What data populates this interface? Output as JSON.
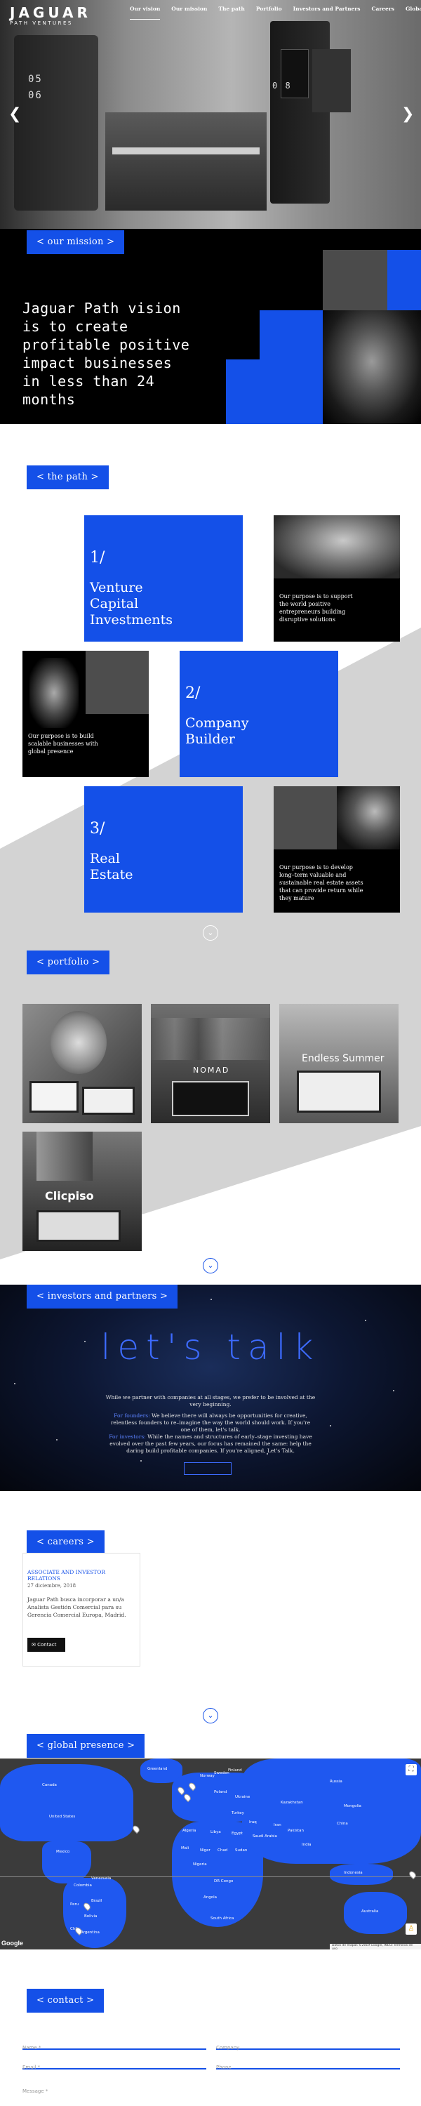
{
  "header": {
    "logo_main": "JAGUAR",
    "logo_sub": "PATH VENTURES",
    "nav": [
      "Our vision",
      "Our mission",
      "The path",
      "Portfolio",
      "Investors and Partners",
      "Careers",
      "Global presence"
    ],
    "active_nav": "Our vision",
    "hero_digits_left": "05",
    "hero_digits_left2": "06",
    "hero_digits_right": "0 8",
    "prev_arrow": "❮",
    "next_arrow": "❯"
  },
  "mission": {
    "tag": "< our mission >",
    "text": "Jaguar Path vision is to create profitable positive impact businesses in less than 24 months"
  },
  "path": {
    "tag": "< the path >",
    "items": [
      {
        "num": "1/",
        "title_line1": "Venture",
        "title_line2": "Capital",
        "title_line3": "Investments",
        "desc": "Our purpose is to support the world positive entrepreneurs building disruptive solutions"
      },
      {
        "num": "2/",
        "title_line1": "Company",
        "title_line2": "Builder",
        "title_line3": "",
        "desc": "Our purpose is to build scalable businesses with global presence"
      },
      {
        "num": "3/",
        "title_line1": "Real",
        "title_line2": "Estate",
        "title_line3": "",
        "desc": "Our purpose is to develop long–term valuable and sustainable real estate assets that can provide return while they mature"
      }
    ],
    "down_icon": "⌄"
  },
  "portfolio": {
    "tag": "< portfolio >",
    "items": [
      {
        "name": "portfolio-item-1",
        "label": ""
      },
      {
        "name": "portfolio-item-nomad",
        "label": "NOMAD"
      },
      {
        "name": "portfolio-item-endless-summer",
        "label": "Endless Summer"
      },
      {
        "name": "portfolio-item-clicpiso",
        "label": "Clicpiso"
      }
    ],
    "down_icon": "⌄"
  },
  "investors": {
    "tag": "< investors and partners >",
    "title": "let's talk",
    "p1": "While we partner with companies at all stages, we prefer to be involved at the very beginning.",
    "founders_label": "For founders:",
    "p2": "We believe there will always be opportunities for creative, relentless founders to re–imagine the way the world should work. If you're one of them, let's talk.",
    "investors_label": "For investors:",
    "p3": "While the names and structures of early–stage investing have evolved over the past few years, our focus has remained the same: help the daring build profitable companies. If you're aligned, Let's Talk.",
    "button": ""
  },
  "careers": {
    "tag": "< careers >",
    "job_title": "ASSOCIATE AND INVESTOR RELATIONS",
    "job_date": "27 diciembre, 2018",
    "job_desc": "Jaguar Path busca incorporar a un/a Analista Gestión Comercial para su Gerencia Comercial Europa, Madrid.",
    "contact_button": "Contact",
    "down_icon": "⌄"
  },
  "global": {
    "tag": "< global presence >",
    "google_label": "Google",
    "map_footer": "Datos de mapas ©2019 Google, INEGI   Términos de uso",
    "labels": [
      "Canada",
      "United States",
      "Mexico",
      "Brazil",
      "Peru",
      "Argentina",
      "Greenland",
      "Russia",
      "Kazakhstan",
      "China",
      "India",
      "Algeria",
      "Libya",
      "Egypt",
      "Mali",
      "Niger",
      "Chad",
      "Sudan",
      "Nigeria",
      "DR Congo",
      "Angola",
      "South Africa",
      "Saudi Arabia",
      "Iran",
      "Mongolia",
      "Australia",
      "Indonesia",
      "Norway",
      "Sweden",
      "Finland",
      "Poland",
      "Ukraine",
      "Turkey",
      "Iraq",
      "Pakistan",
      "Bolivia",
      "Chile",
      "Colombia",
      "Venezuela"
    ]
  },
  "contact": {
    "tag": "< contact >",
    "name_placeholder": "Name *",
    "email_placeholder": "Email *",
    "company_placeholder": "Company",
    "phone_placeholder": "Phone",
    "message_placeholder": "Message *"
  }
}
